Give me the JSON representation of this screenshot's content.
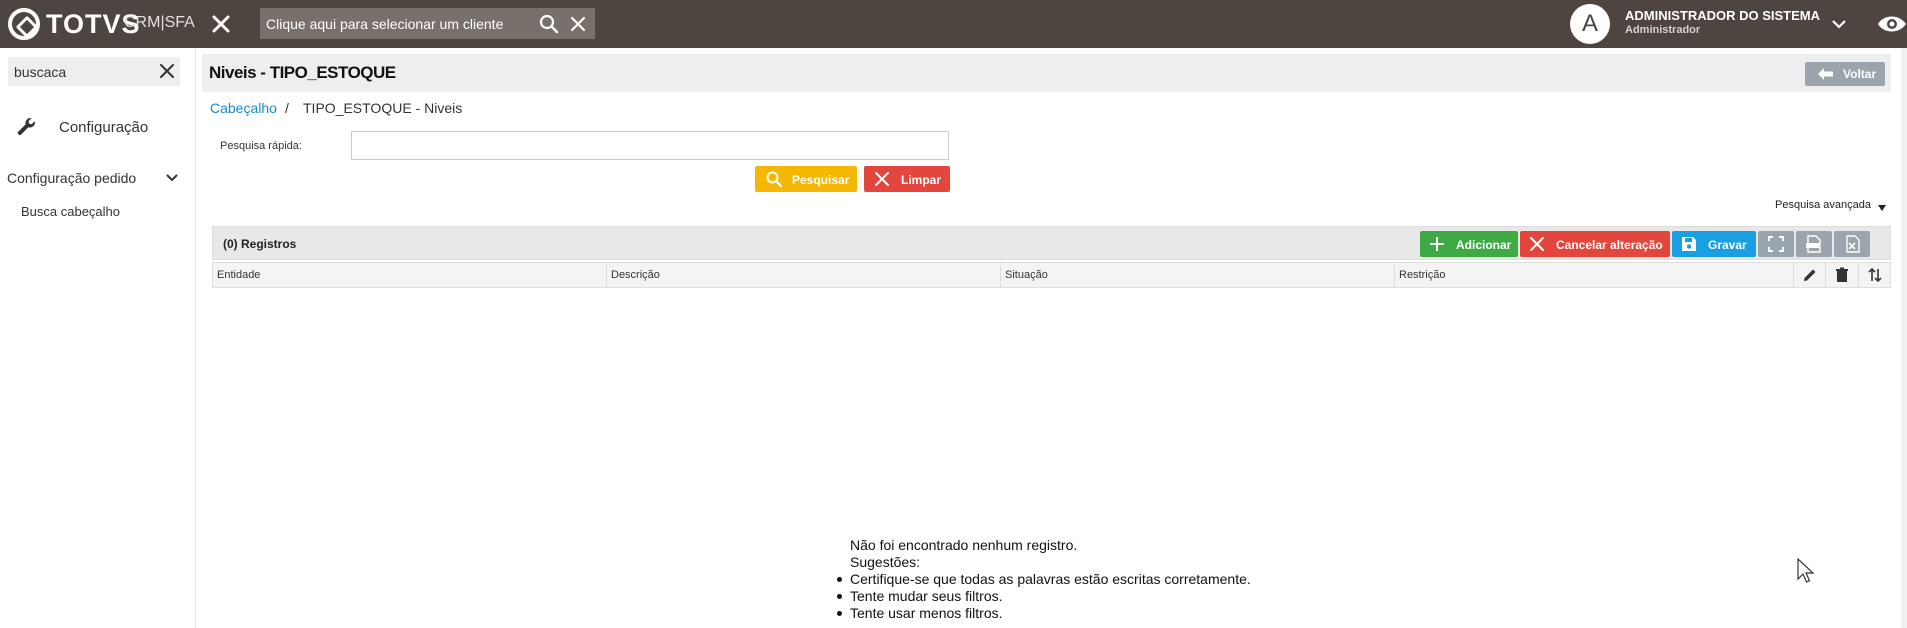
{
  "topbar": {
    "logo_text": "TOTVS",
    "product": "CRM|SFA",
    "client_search_placeholder": "Clique aqui para selecionar um cliente",
    "avatar_letter": "A",
    "user_name": "ADMINISTRADOR DO SISTEMA",
    "user_role": "Administrador"
  },
  "sidebar": {
    "search_value": "buscaca",
    "config_label": "Configuração",
    "group_label": "Configuração pedido",
    "sub_item": "Busca cabeçalho"
  },
  "page": {
    "title": "Niveis - TIPO_ESTOQUE",
    "back_label": "Voltar",
    "breadcrumb_link": "Cabeçalho",
    "breadcrumb_sep": "/",
    "breadcrumb_current": "TIPO_ESTOQUE - Niveis",
    "quick_search_label": "Pesquisa rápida:",
    "quick_search_value": "",
    "search_button": "Pesquisar",
    "clear_button": "Limpar",
    "advanced_search": "Pesquisa avançada"
  },
  "grid": {
    "records_label": "(0) Registros",
    "add_button": "Adicionar",
    "cancel_button": "Cancelar alteração",
    "save_button": "Gravar",
    "columns": [
      "Entidade",
      "Descrição",
      "Situação",
      "Restrição"
    ],
    "empty_title": "Não foi encontrado nenhum registro.",
    "suggestions_label": "Sugestões:",
    "suggestions": [
      "Certifique-se que todas as palavras estão escritas corretamente.",
      "Tente mudar seus filtros.",
      "Tente usar menos filtros."
    ]
  },
  "colors": {
    "topbar": "#4e4440",
    "accent_yellow": "#f5b800",
    "danger_red": "#e3463d",
    "success_green": "#3faa43",
    "primary_blue": "#1a9fe3",
    "link_blue": "#1a8ad1",
    "neutral_grey": "#9aa5ad"
  }
}
